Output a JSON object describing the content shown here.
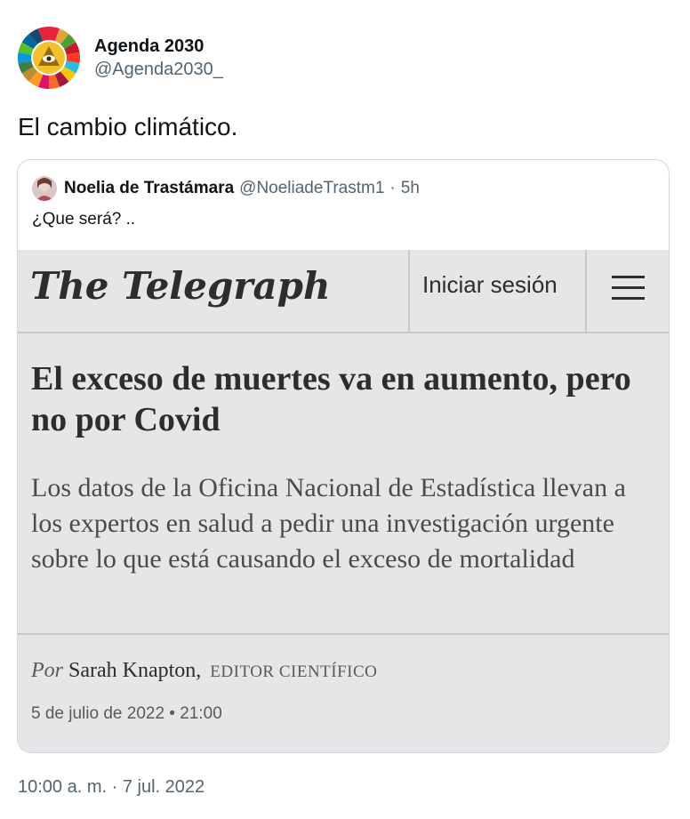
{
  "tweet": {
    "author_name": "Agenda 2030",
    "author_handle": "@Agenda2030_",
    "text": "El cambio climático.",
    "timestamp": "10:00 a. m. · 7 jul. 2022"
  },
  "quote": {
    "author_name": "Noelia de Trastámara",
    "author_handle": "@NoeliadeTrastm1",
    "separator": "·",
    "time": "5h",
    "text": "¿Que será? .."
  },
  "article": {
    "logo": "The Telegraph",
    "login_label": "Iniciar sesión",
    "headline": "El exceso de muertes va en aumento, pero no por Covid",
    "subheadline": "Los datos de la Oficina Nacional de Estadística llevan a los expertos en salud a pedir una investigación urgente sobre lo que está causando el exceso de mortalidad",
    "byline_prefix": "Por",
    "byline_author": "Sarah Knapton,",
    "byline_role": "EDITOR CIENTÍFICO",
    "date": "5 de julio de 2022 • 21:00"
  },
  "icons": {
    "avatar": "sdg-wheel-eye-icon",
    "menu": "hamburger-menu-icon"
  },
  "colors": {
    "text_primary": "#0f1419",
    "text_secondary": "#536471",
    "border": "#cfd9de",
    "article_bg": "#e6e6e8"
  }
}
